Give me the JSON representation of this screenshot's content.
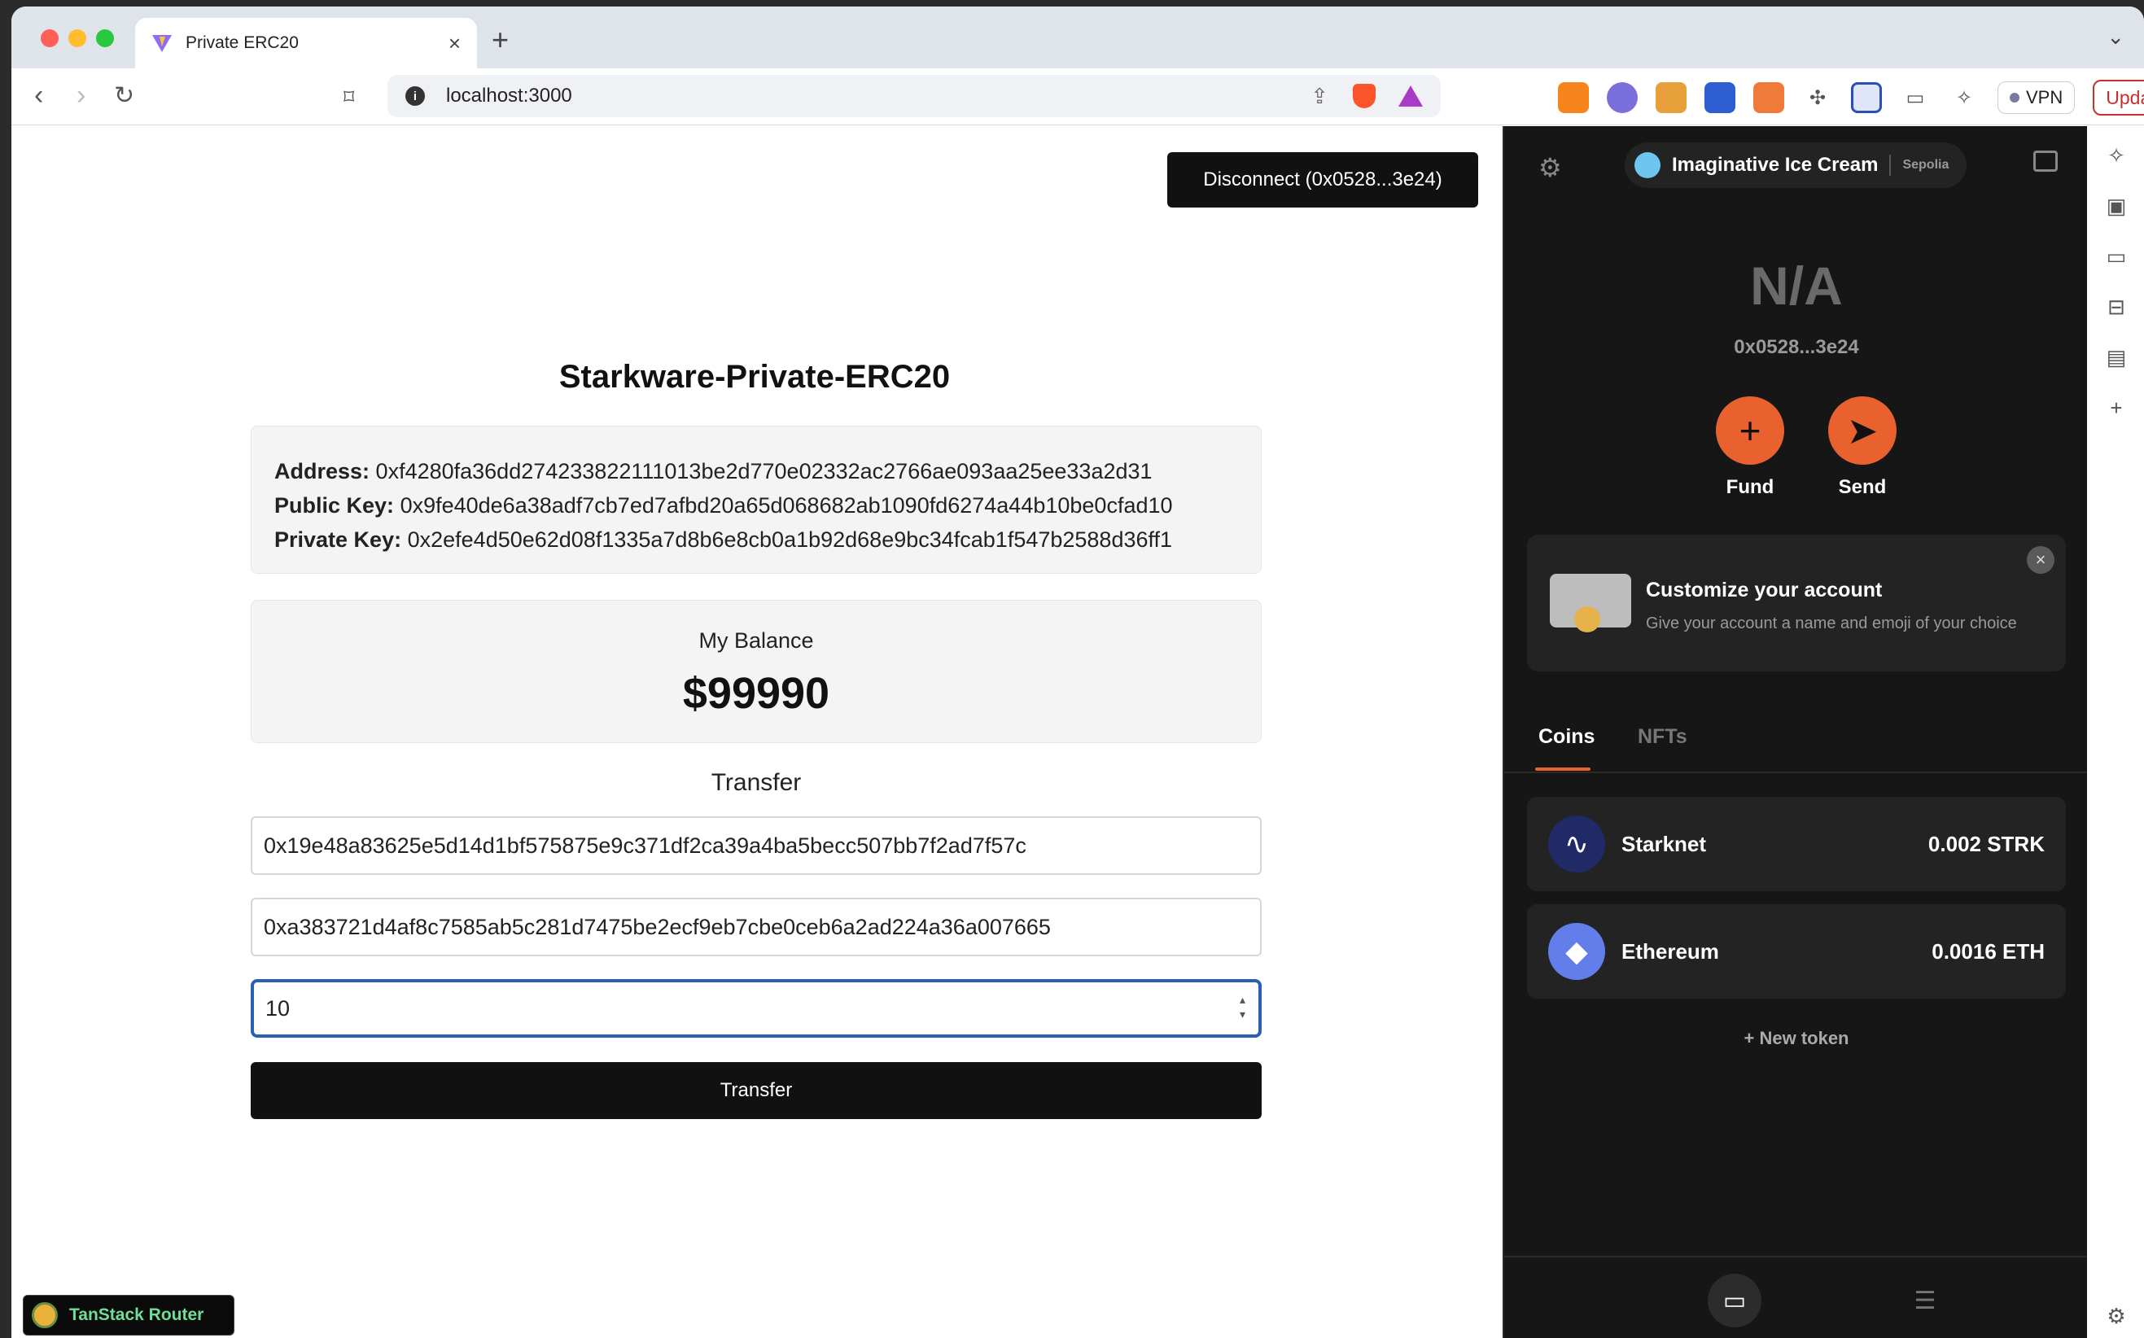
{
  "browser": {
    "tab_title": "Private ERC20",
    "url": "localhost:3000",
    "vpn_label": "VPN",
    "update_label": "Update"
  },
  "page": {
    "disconnect_label": "Disconnect (0x0528...3e24)",
    "title": "Starkware-Private-ERC20",
    "keys": {
      "address_label": "Address:",
      "address_value": "0xf4280fa36dd274233822111013be2d770e02332ac2766ae093aa25ee33a2d31",
      "public_label": "Public Key:",
      "public_value": "0x9fe40de6a38adf7cb7ed7afbd20a65d068682ab1090fd6274a44b10be0cfad10",
      "private_label": "Private Key:",
      "private_value": "0x2efe4d50e62d08f1335a7d8b6e8cb0a1b92d68e9bc34fcab1f547b2588d36ff1"
    },
    "balance": {
      "label": "My Balance",
      "value": "$99990"
    },
    "transfer": {
      "title": "Transfer",
      "field_1": "0x19e48a83625e5d14d1bf575875e9c371df2ca39a4ba5becc507bb7f2ad7f57c",
      "field_2": "0xa383721d4af8c7585ab5c281d7475be2ecf9eb7cbe0ceb6a2ad224a36a007665",
      "amount": "10",
      "button_label": "Transfer"
    },
    "devtools_label": "TanStack Router"
  },
  "wallet": {
    "account_name": "Imaginative Ice Cream",
    "network": "Sepolia",
    "balance": "N/A",
    "address": "0x0528...3e24",
    "fund_label": "Fund",
    "send_label": "Send",
    "customize_title": "Customize your account",
    "customize_subtitle": "Give your account a name and emoji of your choice",
    "tabs": {
      "coins": "Coins",
      "nfts": "NFTs"
    },
    "tokens": [
      {
        "name": "Starknet",
        "amount": "0.002 STRK"
      },
      {
        "name": "Ethereum",
        "amount": "0.0016 ETH"
      }
    ],
    "new_token_label": "New token"
  },
  "colors": {
    "accent": "#e8612f",
    "focus": "#2b5fb4",
    "devtools_text": "#6ddf9a"
  }
}
